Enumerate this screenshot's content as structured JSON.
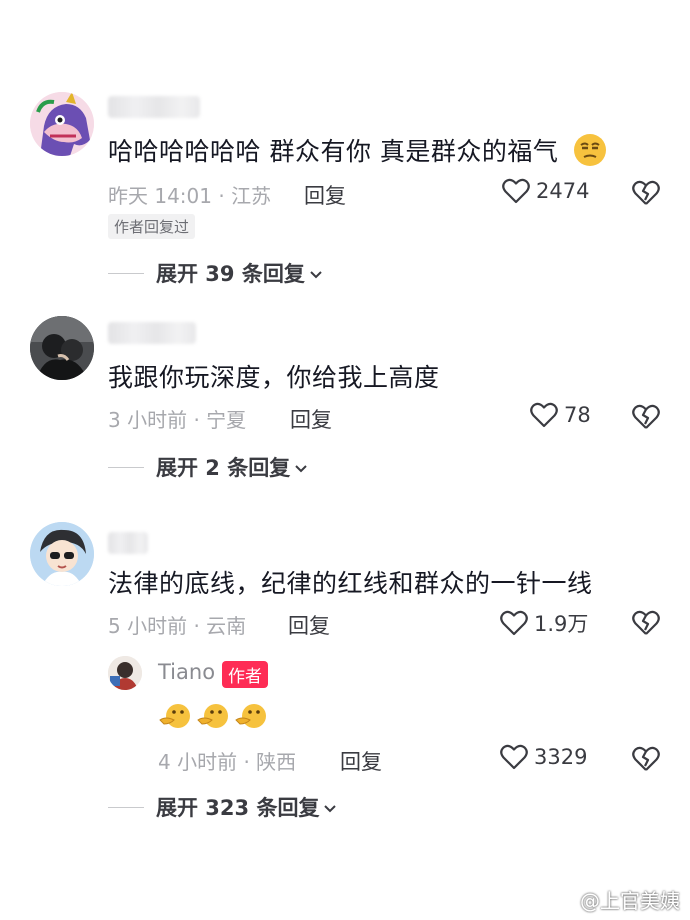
{
  "comments": [
    {
      "text": "哈哈哈哈哈哈 群众有你 真是群众的福气",
      "emoji_icon": "smirk-face-emoji",
      "time_location": "昨天 14:01 · 江苏",
      "reply_label": "回复",
      "likes": "2474",
      "badge": "作者回复过",
      "expand": "展开 39 条回复"
    },
    {
      "text": "我跟你玩深度，你给我上高度",
      "time_location": "3 小时前 · 宁夏",
      "reply_label": "回复",
      "likes": "78",
      "expand": "展开 2 条回复"
    },
    {
      "text": "法律的底线，纪律的红线和群众的一针一线",
      "time_location": "5 小时前 · 云南",
      "reply_label": "回复",
      "likes": "1.9万",
      "reply": {
        "username": "Tiano",
        "author_badge": "作者",
        "emoji_icons": [
          "pointing-face-emoji",
          "pointing-face-emoji",
          "pointing-face-emoji"
        ],
        "time_location": "4 小时前 · 陕西",
        "reply_label": "回复",
        "likes": "3329"
      },
      "expand": "展开 323 条回复"
    }
  ],
  "watermark": "@上官美姨",
  "colors": {
    "accent": "#fe2c55",
    "text": "#161823",
    "meta": "#a7a8ad"
  }
}
